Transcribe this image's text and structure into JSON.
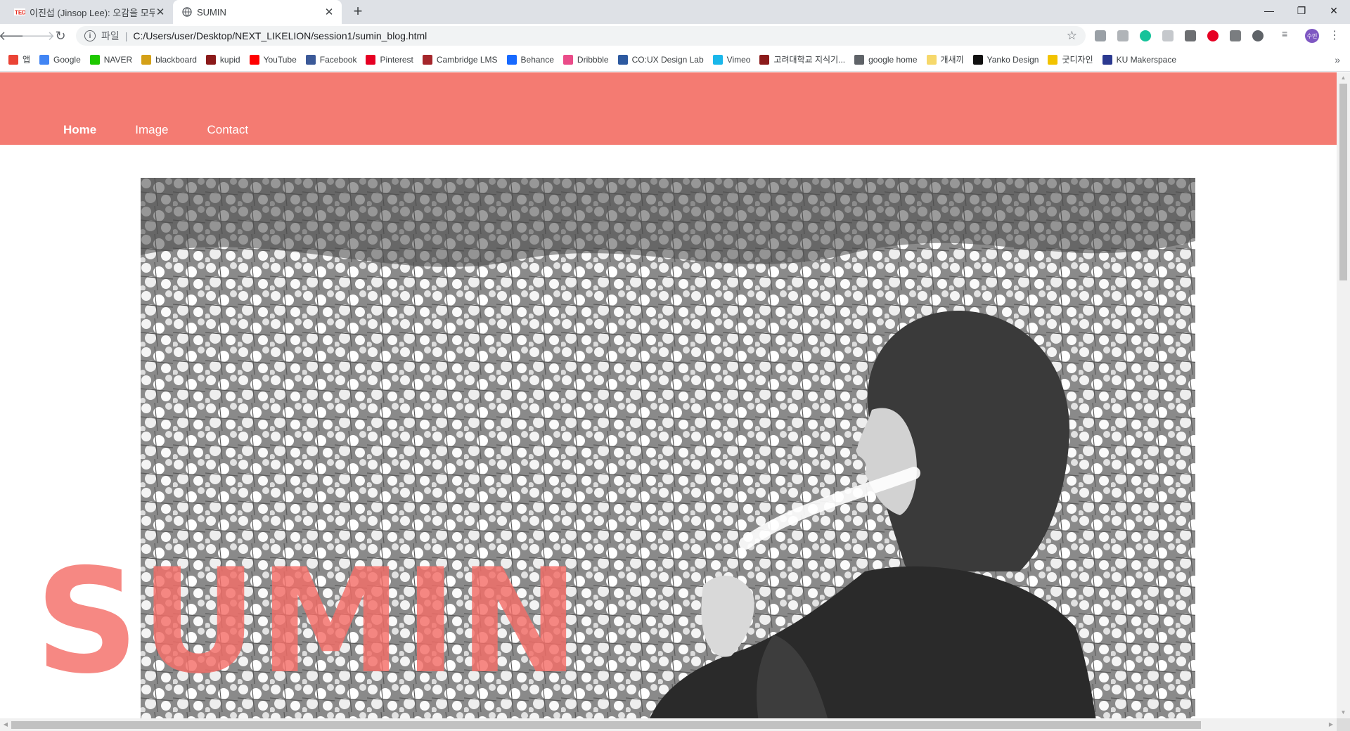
{
  "browser": {
    "tabs": [
      {
        "title": "이진섭 (Jinsop Lee): 오감을 모두",
        "favicon": "ted-icon",
        "active": false
      },
      {
        "title": "SUMIN",
        "favicon": "globe-icon",
        "active": true
      }
    ],
    "address": {
      "scheme_label": "파일",
      "url": "C:/Users/user/Desktop/NEXT_LIKELION/session1/sumin_blog.html"
    },
    "profile_initial": "수민",
    "bookmarks": [
      {
        "label": "앱",
        "icon": "apps-grid-icon",
        "color": "#ea4335"
      },
      {
        "label": "Google",
        "icon": "google-icon",
        "color": "#4285f4"
      },
      {
        "label": "NAVER",
        "icon": "naver-icon",
        "color": "#1ec800"
      },
      {
        "label": "blackboard",
        "icon": "blackboard-icon",
        "color": "#d4a017"
      },
      {
        "label": "kupid",
        "icon": "kupid-icon",
        "color": "#8b1a1a"
      },
      {
        "label": "YouTube",
        "icon": "youtube-icon",
        "color": "#ff0000"
      },
      {
        "label": "Facebook",
        "icon": "facebook-icon",
        "color": "#3b5998"
      },
      {
        "label": "Pinterest",
        "icon": "pinterest-icon",
        "color": "#e60023"
      },
      {
        "label": "Cambridge LMS",
        "icon": "cambridge-icon",
        "color": "#a5262b"
      },
      {
        "label": "Behance",
        "icon": "behance-icon",
        "color": "#1769ff"
      },
      {
        "label": "Dribbble",
        "icon": "dribbble-icon",
        "color": "#ea4c89"
      },
      {
        "label": "CO:UX Design Lab",
        "icon": "coux-icon",
        "color": "#2d5aa0"
      },
      {
        "label": "Vimeo",
        "icon": "vimeo-icon",
        "color": "#1ab7ea"
      },
      {
        "label": "고려대학교 지식기...",
        "icon": "korea-univ-icon",
        "color": "#8b1a1a"
      },
      {
        "label": "google home",
        "icon": "globe-icon",
        "color": "#5f6368"
      },
      {
        "label": "개새끼",
        "icon": "folder-icon",
        "color": "#f6d86b"
      },
      {
        "label": "Yanko Design",
        "icon": "yanko-icon",
        "color": "#111111"
      },
      {
        "label": "굿디자인",
        "icon": "good-design-icon",
        "color": "#f2c300"
      },
      {
        "label": "KU Makerspace",
        "icon": "makerspace-icon",
        "color": "#2b3990"
      }
    ]
  },
  "site": {
    "nav": [
      {
        "label": "Home",
        "active": true
      },
      {
        "label": "Image",
        "active": false
      },
      {
        "label": "Contact",
        "active": false
      }
    ],
    "hero_title": "SUMIN",
    "header_color": "#f47b72"
  }
}
